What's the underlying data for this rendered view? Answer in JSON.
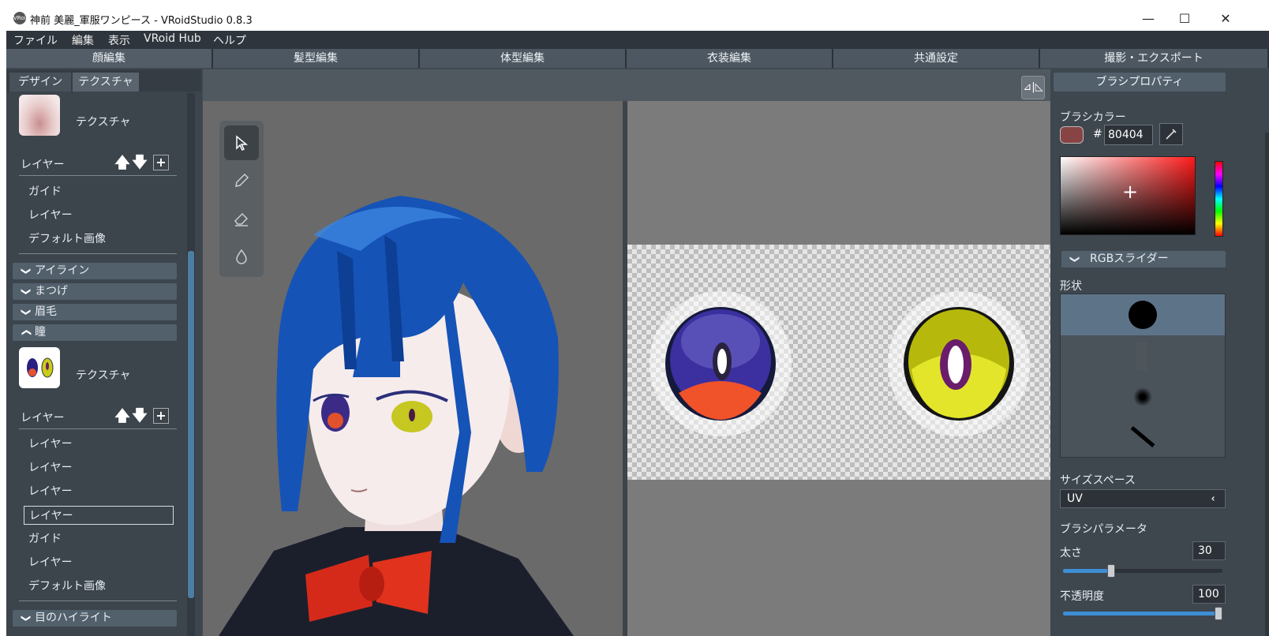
{
  "window": {
    "app_icon": "VRoid",
    "title": "神前 美麗_軍服ワンピース - VRoidStudio 0.8.3",
    "minimize": "—",
    "maximize": "☐",
    "close": "✕"
  },
  "menu": [
    "ファイル",
    "編集",
    "表示",
    "VRoid Hub",
    "ヘルプ"
  ],
  "mode_tabs": [
    "顔編集",
    "髪型編集",
    "体型編集",
    "衣装編集",
    "共通設定",
    "撮影・エクスポート"
  ],
  "left": {
    "subtabs": [
      "デザイン",
      "テクスチャ"
    ],
    "block1": {
      "texture_label": "テクスチャ",
      "layer_header": "レイヤー",
      "rows": [
        "ガイド",
        "レイヤー",
        "デフォルト画像"
      ]
    },
    "sections": [
      "アイライン",
      "まつげ",
      "眉毛",
      "瞳"
    ],
    "block2": {
      "texture_label": "テクスチャ",
      "layer_header": "レイヤー",
      "rows": [
        "レイヤー",
        "レイヤー",
        "レイヤー",
        "レイヤー",
        "ガイド",
        "レイヤー",
        "デフォルト画像"
      ]
    },
    "last_section": "目のハイライト"
  },
  "icons": {
    "up": "🡅",
    "down": "🡇",
    "add": "+",
    "chevron_down": "⌄",
    "chevron_up": "⌃"
  },
  "right": {
    "header": "ブラシプロパティ",
    "brush_color_label": "ブラシカラー",
    "hash": "#",
    "hex": "80404",
    "swatch_color": "#884444",
    "rgb_slider": "RGBスライダー",
    "shape_label": "形状",
    "size_space_label": "サイズスペース",
    "size_space_value": "UV",
    "brush_params_label": "ブラシパラメータ",
    "thickness_label": "太さ",
    "thickness_value": "30",
    "thickness_fraction": 0.3,
    "opacity_label": "不透明度",
    "opacity_value": "100",
    "opacity_fraction": 1.0
  }
}
